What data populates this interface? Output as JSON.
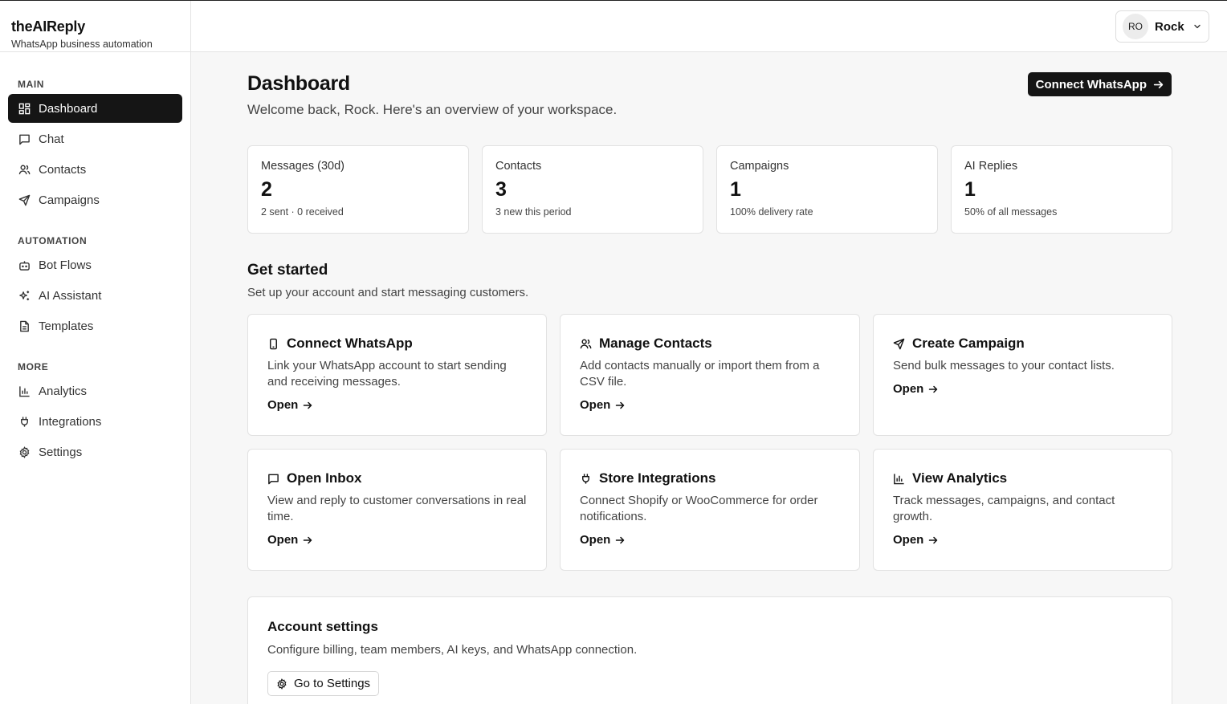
{
  "brand": {
    "name": "theAIReply",
    "tagline": "WhatsApp business automation"
  },
  "sidebar": {
    "sections": [
      {
        "label": "MAIN",
        "items": [
          {
            "label": "Dashboard",
            "icon": "grid-icon",
            "active": true
          },
          {
            "label": "Chat",
            "icon": "chat-icon"
          },
          {
            "label": "Contacts",
            "icon": "users-icon"
          },
          {
            "label": "Campaigns",
            "icon": "send-icon"
          }
        ]
      },
      {
        "label": "AUTOMATION",
        "items": [
          {
            "label": "Bot Flows",
            "icon": "bot-icon"
          },
          {
            "label": "AI Assistant",
            "icon": "sparkles-icon"
          },
          {
            "label": "Templates",
            "icon": "file-icon"
          }
        ]
      },
      {
        "label": "MORE",
        "items": [
          {
            "label": "Analytics",
            "icon": "bar-chart-icon"
          },
          {
            "label": "Integrations",
            "icon": "plug-icon"
          },
          {
            "label": "Settings",
            "icon": "gear-icon"
          }
        ]
      }
    ]
  },
  "user": {
    "initials": "RO",
    "name": "Rock"
  },
  "header": {
    "title": "Dashboard",
    "subtitle": "Welcome back, Rock. Here's an overview of your workspace.",
    "primary_action": "Connect WhatsApp"
  },
  "stats": [
    {
      "label": "Messages (30d)",
      "value": "2",
      "note": "2 sent · 0 received"
    },
    {
      "label": "Contacts",
      "value": "3",
      "note": "3 new this period"
    },
    {
      "label": "Campaigns",
      "value": "1",
      "note": "100% delivery rate"
    },
    {
      "label": "AI Replies",
      "value": "1",
      "note": "50% of all messages"
    }
  ],
  "get_started": {
    "title": "Get started",
    "subtitle": "Set up your account and start messaging customers.",
    "cards": [
      {
        "title": "Connect WhatsApp",
        "desc": "Link your WhatsApp account to start sending and receiving messages.",
        "link": "Open",
        "icon": "phone-icon"
      },
      {
        "title": "Manage Contacts",
        "desc": "Add contacts manually or import them from a CSV file.",
        "link": "Open",
        "icon": "users-icon"
      },
      {
        "title": "Create Campaign",
        "desc": "Send bulk messages to your contact lists.",
        "link": "Open",
        "icon": "send-icon"
      },
      {
        "title": "Open Inbox",
        "desc": "View and reply to customer conversations in real time.",
        "link": "Open",
        "icon": "chat-icon"
      },
      {
        "title": "Store Integrations",
        "desc": "Connect Shopify or WooCommerce for order notifications.",
        "link": "Open",
        "icon": "plug-icon"
      },
      {
        "title": "View Analytics",
        "desc": "Track messages, campaigns, and contact growth.",
        "link": "Open",
        "icon": "bar-chart-icon"
      }
    ]
  },
  "account_settings": {
    "title": "Account settings",
    "subtitle": "Configure billing, team members, AI keys, and WhatsApp connection.",
    "button": "Go to Settings"
  }
}
